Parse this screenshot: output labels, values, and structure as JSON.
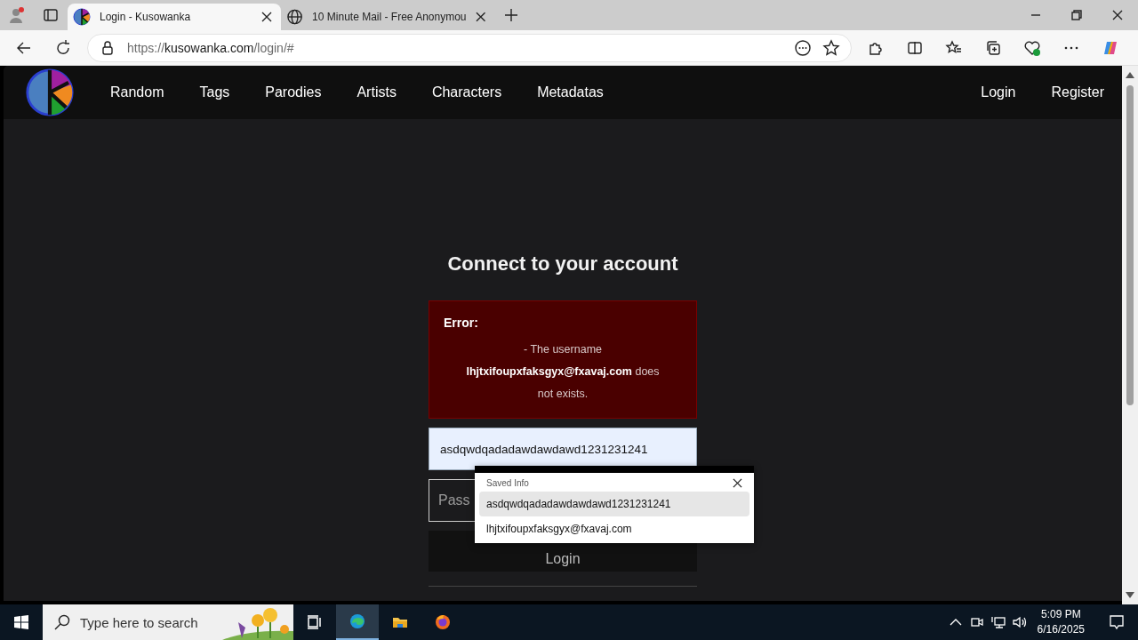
{
  "browser": {
    "tabs": [
      {
        "title": "Login - Kusowanka",
        "kind": "site",
        "selected": true
      },
      {
        "title": "10 Minute Mail - Free Anonymou",
        "kind": "globe",
        "selected": false
      }
    ],
    "address": {
      "scheme": "https://",
      "host": "kusowanka.com",
      "path": "/login/#"
    }
  },
  "nav": {
    "links": [
      "Random",
      "Tags",
      "Parodies",
      "Artists",
      "Characters",
      "Metadatas"
    ],
    "account_links": [
      "Login",
      "Register"
    ]
  },
  "login": {
    "heading": "Connect to your account",
    "error": {
      "title": "Error:",
      "message": "- The username **lhjtxifoupxfaksgyx@fxavaj.com** does not exists."
    },
    "username": {
      "value": "asdqwdqadadawdawdawd1231231241",
      "focused": true
    },
    "password": {
      "placeholder": "Pass"
    },
    "button": "Login"
  },
  "autofill": {
    "title": "Saved Info",
    "items": [
      {
        "text": "asdqwdqadadawdawdawd1231231241",
        "selected": true
      },
      {
        "text": "lhjtxifoupxfaksgyx@fxavaj.com",
        "selected": false
      }
    ]
  },
  "taskbar": {
    "search_placeholder": "Type here to search",
    "apps": [
      {
        "kind": "taskview",
        "active": false
      },
      {
        "kind": "edge",
        "active": true
      },
      {
        "kind": "files",
        "active": false
      },
      {
        "kind": "firefox",
        "active": false
      }
    ],
    "time": "5:09 PM",
    "date": "6/16/2025"
  }
}
